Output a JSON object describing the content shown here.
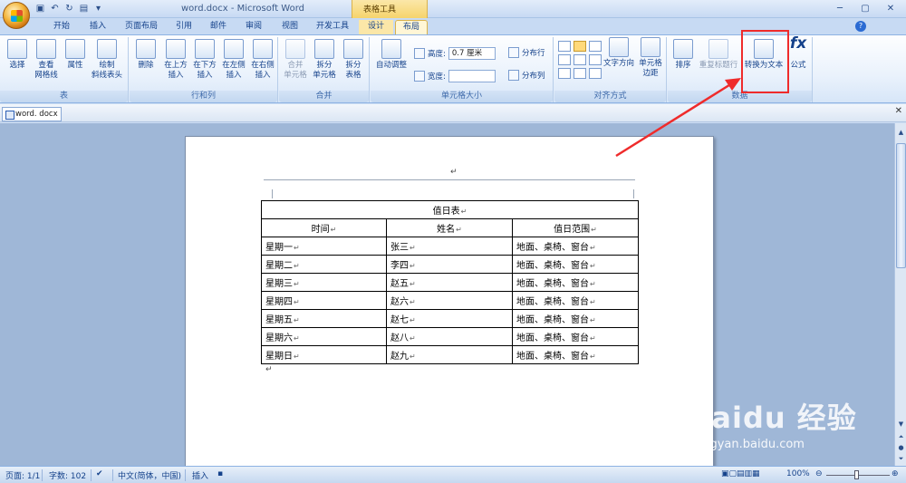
{
  "window": {
    "title": "word.docx - Microsoft Word",
    "contextual_group": "表格工具"
  },
  "tabs": [
    "开始",
    "插入",
    "页面布局",
    "引用",
    "邮件",
    "审阅",
    "视图",
    "开发工具",
    "设计",
    "布局"
  ],
  "active_tab": "布局",
  "ribbon": {
    "table_group": {
      "label": "表",
      "select": "选择",
      "gridlines": "查看\n网格线",
      "properties": "属性",
      "draw_diagonal": "绘制\n斜线表头"
    },
    "rows_cols_group": {
      "label": "行和列",
      "delete": "删除",
      "insert_above": "在上方\n插入",
      "insert_below": "在下方\n插入",
      "insert_left": "在左侧\n插入",
      "insert_right": "在右侧\n插入"
    },
    "merge_group": {
      "label": "合并",
      "merge_cells": "合并\n单元格",
      "split_cells": "拆分\n单元格",
      "split_table": "拆分\n表格"
    },
    "cell_size_group": {
      "label": "单元格大小",
      "autofit": "自动调整",
      "height_label": "高度:",
      "height_value": "0.7 厘米",
      "width_label": "宽度:",
      "width_value": "",
      "distribute_rows": "分布行",
      "distribute_cols": "分布列"
    },
    "alignment_group": {
      "label": "对齐方式",
      "text_direction": "文字方向",
      "cell_margins": "单元格\n边距"
    },
    "data_group": {
      "label": "数据",
      "sort": "排序",
      "repeat_header": "重复标题行",
      "convert_to_text": "转换为文本",
      "formula": "公式"
    }
  },
  "doc_tab": "word. docx",
  "table": {
    "title": "值日表",
    "headers": [
      "时间",
      "姓名",
      "值日范围"
    ],
    "rows": [
      [
        "星期一",
        "张三",
        "地面、桌椅、窗台"
      ],
      [
        "星期二",
        "李四",
        "地面、桌椅、窗台"
      ],
      [
        "星期三",
        "赵五",
        "地面、桌椅、窗台"
      ],
      [
        "星期四",
        "赵六",
        "地面、桌椅、窗台"
      ],
      [
        "星期五",
        "赵七",
        "地面、桌椅、窗台"
      ],
      [
        "星期六",
        "赵八",
        "地面、桌椅、窗台"
      ],
      [
        "星期日",
        "赵九",
        "地面、桌椅、窗台"
      ]
    ],
    "para_mark": "↵"
  },
  "status_bar": {
    "page": "页面: 1/1",
    "words": "字数: 102",
    "language": "中文(简体，中国)",
    "mode": "插入",
    "zoom": "100%"
  },
  "watermark": {
    "brand": "Baidu 经验",
    "url": "jingyan.baidu.com"
  },
  "colors": {
    "annotation": "#ef2b2b",
    "ribbon_text": "#15428b",
    "tools_tab": "#fbe7a8"
  }
}
